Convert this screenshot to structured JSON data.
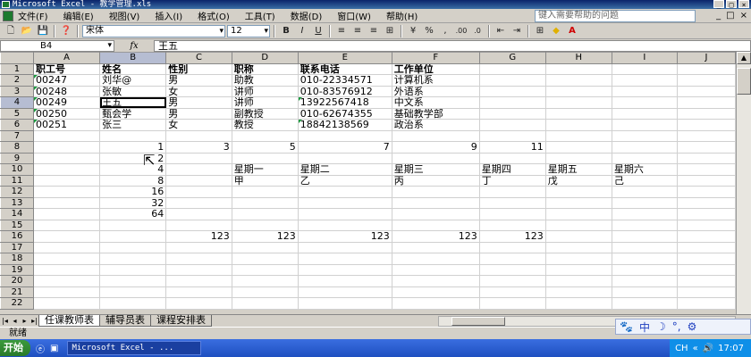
{
  "window": {
    "title": "Microsoft Excel - 教学管理.xls",
    "buttons": [
      "_",
      "□",
      "×"
    ]
  },
  "menu": {
    "items": [
      "文件(F)",
      "编辑(E)",
      "视图(V)",
      "插入(I)",
      "格式(O)",
      "工具(T)",
      "数据(D)",
      "窗口(W)",
      "帮助(H)"
    ],
    "help_placeholder": "键入需要帮助的问题",
    "right_controls": [
      "_",
      "□",
      "×"
    ]
  },
  "toolbar": {
    "font_name": "宋体",
    "font_size": "12",
    "bold": "B",
    "italic": "I",
    "underline": "U",
    "percent": "%",
    "comma": ",",
    "increase_decimal": ".00",
    "decrease_decimal": ".0"
  },
  "formula_bar": {
    "name_box": "B4",
    "fx": "fx",
    "content": "王五"
  },
  "columns": [
    "A",
    "B",
    "C",
    "D",
    "E",
    "F",
    "G",
    "H",
    "I",
    "J"
  ],
  "selected_column": "B",
  "selected_row": "4",
  "rows": [
    {
      "n": "1",
      "cells": [
        "职工号",
        "姓名",
        "性别",
        "职称",
        "联系电话",
        "工作单位",
        "",
        "",
        "",
        ""
      ]
    },
    {
      "n": "2",
      "cells": [
        "00247",
        "刘华@",
        "男",
        "助教",
        "010-22334571",
        "计算机系",
        "",
        "",
        "",
        ""
      ]
    },
    {
      "n": "3",
      "cells": [
        "00248",
        "张敏",
        "女",
        "讲师",
        "010-83576912",
        "外语系",
        "",
        "",
        "",
        ""
      ]
    },
    {
      "n": "4",
      "cells": [
        "00249",
        "王五",
        "男",
        "讲师",
        "13922567418",
        "中文系",
        "",
        "",
        "",
        ""
      ]
    },
    {
      "n": "5",
      "cells": [
        "00250",
        "甄会学",
        "男",
        "副教授",
        "010-62674355",
        "基础教学部",
        "",
        "",
        "",
        ""
      ]
    },
    {
      "n": "6",
      "cells": [
        "00251",
        "张三",
        "女",
        "教授",
        "18842138569",
        "政治系",
        "",
        "",
        "",
        ""
      ]
    },
    {
      "n": "7",
      "cells": [
        "",
        "",
        "",
        "",
        "",
        "",
        "",
        "",
        "",
        ""
      ]
    },
    {
      "n": "8",
      "cells": [
        "",
        "1",
        "3",
        "5",
        "7",
        "9",
        "11",
        "",
        "",
        ""
      ]
    },
    {
      "n": "9",
      "cells": [
        "",
        "2",
        "",
        "",
        "",
        "",
        "",
        "",
        "",
        ""
      ]
    },
    {
      "n": "10",
      "cells": [
        "",
        "4",
        "",
        "星期一",
        "星期二",
        "星期三",
        "星期四",
        "星期五",
        "星期六",
        ""
      ]
    },
    {
      "n": "11",
      "cells": [
        "",
        "8",
        "",
        "甲",
        "乙",
        "丙",
        "丁",
        "戊",
        "己",
        ""
      ]
    },
    {
      "n": "12",
      "cells": [
        "",
        "16",
        "",
        "",
        "",
        "",
        "",
        "",
        "",
        ""
      ]
    },
    {
      "n": "13",
      "cells": [
        "",
        "32",
        "",
        "",
        "",
        "",
        "",
        "",
        "",
        ""
      ]
    },
    {
      "n": "14",
      "cells": [
        "",
        "64",
        "",
        "",
        "",
        "",
        "",
        "",
        "",
        ""
      ]
    },
    {
      "n": "15",
      "cells": [
        "",
        "",
        "",
        "",
        "",
        "",
        "",
        "",
        "",
        ""
      ]
    },
    {
      "n": "16",
      "cells": [
        "",
        "",
        "123",
        "123",
        "123",
        "123",
        "123",
        "",
        "",
        ""
      ]
    },
    {
      "n": "17",
      "cells": [
        "",
        "",
        "",
        "",
        "",
        "",
        "",
        "",
        "",
        ""
      ]
    },
    {
      "n": "18",
      "cells": [
        "",
        "",
        "",
        "",
        "",
        "",
        "",
        "",
        "",
        ""
      ]
    },
    {
      "n": "19",
      "cells": [
        "",
        "",
        "",
        "",
        "",
        "",
        "",
        "",
        "",
        ""
      ]
    },
    {
      "n": "20",
      "cells": [
        "",
        "",
        "",
        "",
        "",
        "",
        "",
        "",
        "",
        ""
      ]
    },
    {
      "n": "21",
      "cells": [
        "",
        "",
        "",
        "",
        "",
        "",
        "",
        "",
        "",
        ""
      ]
    },
    {
      "n": "22",
      "cells": [
        "",
        "",
        "",
        "",
        "",
        "",
        "",
        "",
        "",
        ""
      ]
    }
  ],
  "sheets": [
    "任课教师表",
    "辅导员表",
    "课程安排表"
  ],
  "active_sheet": "任课教师表",
  "status": "就绪",
  "ime": [
    "中",
    "☽",
    "°,",
    "⚙"
  ],
  "taskbar": {
    "start": "开始",
    "task": "Microsoft Excel - ...",
    "tray_lang": "CH",
    "time": "17:07"
  }
}
